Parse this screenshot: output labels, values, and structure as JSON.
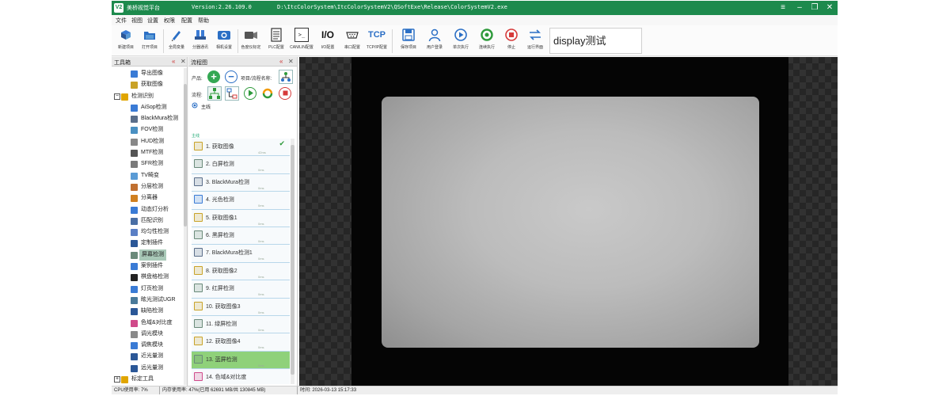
{
  "titlebar": {
    "logo": "V2",
    "app_name": "美桥视觉平台",
    "version": "Version:2.26.109.0",
    "path": "D:\\ItcColorSystem\\ItcColorSystemV2\\QSoftExe\\Release\\ColorSystemV2.exe",
    "menu_icon": "≡",
    "minimize": "–",
    "maximize": "❐",
    "close": "✕"
  },
  "menu": [
    "文件",
    "视图",
    "设置",
    "权限",
    "配置",
    "帮助"
  ],
  "toolbar": {
    "tools": [
      {
        "label": "新建项目",
        "icon": "new-project-icon"
      },
      {
        "label": "打开项目",
        "icon": "open-project-icon"
      },
      {
        "label": "全局变量",
        "icon": "global-variable-icon"
      },
      {
        "label": "分器通讯",
        "icon": "device-communication-icon"
      },
      {
        "label": "相机设置",
        "icon": "camera-settings-icon"
      },
      {
        "label": "色度仪标定",
        "icon": "colorimeter-calibration-icon"
      },
      {
        "label": "PLC配置",
        "icon": "plc-config-icon"
      },
      {
        "label": "CAN/LIN配置",
        "icon": "terminal-icon"
      },
      {
        "label": "I/O配置",
        "icon": "io-config-icon"
      },
      {
        "label": "串口配置",
        "icon": "serial-port-icon"
      },
      {
        "label": "TCP/IP配置",
        "icon": "tcp-icon"
      },
      {
        "label": "保存项目",
        "icon": "save-icon"
      },
      {
        "label": "用户登录",
        "icon": "user-login-icon"
      },
      {
        "label": "单次执行",
        "icon": "run-once-icon"
      },
      {
        "label": "连续执行",
        "icon": "run-continuous-icon"
      },
      {
        "label": "停止",
        "icon": "stop-icon"
      },
      {
        "label": "运行界面",
        "icon": "run-interface-icon"
      }
    ],
    "io_glyph": "I/O",
    "tcp_glyph": "TCP",
    "terminal_glyph": ">_",
    "display_text": "display测试"
  },
  "toolbox": {
    "title": "工具箱",
    "controls": [
      "«",
      "✕"
    ],
    "items": [
      {
        "label": "导出图像",
        "indent": 2,
        "color": "#3a7bd5"
      },
      {
        "label": "获取图像",
        "indent": 2,
        "color": "#c9a227"
      },
      {
        "label": "检测识别",
        "indent": 0,
        "color": "#e0a500",
        "expander": "−"
      },
      {
        "label": "AiSop检测",
        "indent": 2,
        "color": "#3a7bd5"
      },
      {
        "label": "BlackMura检测",
        "indent": 2,
        "color": "#5a6e8a"
      },
      {
        "label": "FOV检测",
        "indent": 2,
        "color": "#4a90c2"
      },
      {
        "label": "HUD检测",
        "indent": 2,
        "color": "#888888"
      },
      {
        "label": "MTF检测",
        "indent": 2,
        "color": "#555555"
      },
      {
        "label": "SFR检测",
        "indent": 2,
        "color": "#7a7a7a"
      },
      {
        "label": "TV畸变",
        "indent": 2,
        "color": "#5a9bd5"
      },
      {
        "label": "分层检测",
        "indent": 2,
        "color": "#c07030"
      },
      {
        "label": "分离器",
        "indent": 2,
        "color": "#d08020"
      },
      {
        "label": "动态灯分析",
        "indent": 2,
        "color": "#3a7bd5"
      },
      {
        "label": "匹配识别",
        "indent": 2,
        "color": "#4a6fa5"
      },
      {
        "label": "均匀性检测",
        "indent": 2,
        "color": "#5a7fc5"
      },
      {
        "label": "定制插件",
        "indent": 2,
        "color": "#2b5797"
      },
      {
        "label": "屏幕检测",
        "indent": 2,
        "color": "#6a8a7a",
        "selected": true
      },
      {
        "label": "案例插件",
        "indent": 2,
        "color": "#3a7bd5"
      },
      {
        "label": "棋盘格检测",
        "indent": 2,
        "color": "#222222"
      },
      {
        "label": "灯页检测",
        "indent": 2,
        "color": "#3a7bd5"
      },
      {
        "label": "眩光测试UGR",
        "indent": 2,
        "color": "#4a7a9a"
      },
      {
        "label": "缺陷检测",
        "indent": 2,
        "color": "#2b5797"
      },
      {
        "label": "色域&对比度",
        "indent": 2,
        "color": "#d04a8a"
      },
      {
        "label": "调光模块",
        "indent": 2,
        "color": "#8a8a8a"
      },
      {
        "label": "调焦模块",
        "indent": 2,
        "color": "#3a7bd5"
      },
      {
        "label": "近光量测",
        "indent": 2,
        "color": "#2b5797"
      },
      {
        "label": "远光量测",
        "indent": 2,
        "color": "#2b5797"
      },
      {
        "label": "标定工具",
        "indent": 0,
        "color": "#e0a500",
        "expander": "+"
      }
    ]
  },
  "flow": {
    "title": "流程图",
    "controls": [
      "«",
      "✕"
    ],
    "product_label": "产品:",
    "project_label": "项目/流程名称:",
    "flow_label": "流程:",
    "add_glyph": "+",
    "remove_glyph": "−",
    "main_node": "主线",
    "steps_section": "主线",
    "check_glyph": "✔",
    "steps": [
      {
        "name": "1. 获取图像",
        "time": "42ms",
        "icon_color": "#c9a227",
        "done": true
      },
      {
        "name": "2. 白屏检测",
        "time": "0ms",
        "icon_color": "#6a8a7a"
      },
      {
        "name": "3. BlackMura检测",
        "time": "0ms",
        "icon_color": "#5a6e8a"
      },
      {
        "name": "4. 光色检测",
        "time": "0ms",
        "icon_color": "#3a7bd5"
      },
      {
        "name": "5. 获取图像1",
        "time": "0ms",
        "icon_color": "#c9a227"
      },
      {
        "name": "6. 黑屏检测",
        "time": "0ms",
        "icon_color": "#6a8a7a"
      },
      {
        "name": "7. BlackMura检测1",
        "time": "0ms",
        "icon_color": "#5a6e8a"
      },
      {
        "name": "8. 获取图像2",
        "time": "0ms",
        "icon_color": "#c9a227"
      },
      {
        "name": "9. 红屏检测",
        "time": "0ms",
        "icon_color": "#6a8a7a"
      },
      {
        "name": "10. 获取图像3",
        "time": "0ms",
        "icon_color": "#c9a227"
      },
      {
        "name": "11. 绿屏检测",
        "time": "0ms",
        "icon_color": "#6a8a7a"
      },
      {
        "name": "12. 获取图像4",
        "time": "0ms",
        "icon_color": "#c9a227"
      },
      {
        "name": "13. 蓝屏检测",
        "time": "0ms",
        "icon_color": "#6a8a7a",
        "active": true
      },
      {
        "name": "14. 色域&对比度",
        "time": "",
        "icon_color": "#d04a8a"
      }
    ]
  },
  "status": {
    "cpu": "CPU使用率: 7%",
    "memory": "内存使用率: 47%(已用 62691 MB/共 130845 MB)",
    "time": "时间: 2026-03-13 15:17:33"
  },
  "colors": {
    "title_bar": "#1d8a4d",
    "active_step": "#8fd17a",
    "selected_tool": "#a9c9b8"
  }
}
